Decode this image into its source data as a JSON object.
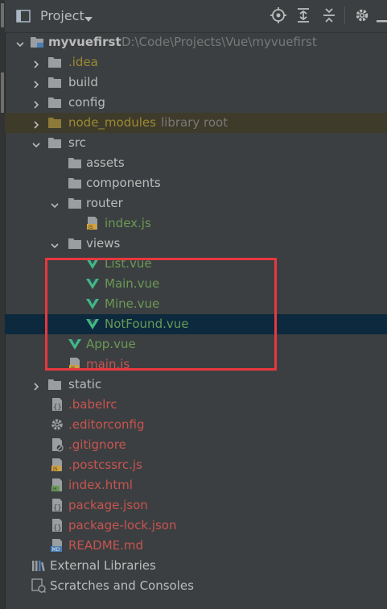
{
  "toolbar": {
    "title": "Project",
    "icons": [
      "project-view-icon",
      "dropdown-icon",
      "locate-icon",
      "expand-all-icon",
      "collapse-all-icon",
      "settings-icon",
      "hide-icon"
    ]
  },
  "colors": {
    "default_text": "#bbbbbb",
    "vue_file": "#6a9955",
    "js_file": "#c75450",
    "config_file": "#c75450",
    "excluded": "#9b8a32",
    "excluded_bg": "#3f3b2b",
    "selected_bg": "#0d293e",
    "highlight": "#e8383d",
    "folder": "#9a9ea1",
    "vue_green": "#41b883"
  },
  "tree": {
    "root": {
      "label": "myvuefirst",
      "path": "D:\\Code\\Projects\\Vue\\myvuefirst"
    },
    "items": [
      {
        "label": ".idea",
        "type": "folder",
        "state": "collapsed",
        "style": "vcs"
      },
      {
        "label": "build",
        "type": "folder",
        "state": "collapsed"
      },
      {
        "label": "config",
        "type": "folder",
        "state": "collapsed"
      },
      {
        "label": "node_modules",
        "extra": "library root",
        "type": "folder",
        "state": "collapsed",
        "style": "excluded"
      },
      {
        "label": "src",
        "type": "folder",
        "state": "expanded"
      },
      {
        "label": "assets",
        "type": "folder"
      },
      {
        "label": "components",
        "type": "folder"
      },
      {
        "label": "router",
        "type": "folder",
        "state": "expanded"
      },
      {
        "label": "index.js",
        "type": "js"
      },
      {
        "label": "views",
        "type": "folder",
        "state": "expanded"
      },
      {
        "label": "List.vue",
        "type": "vue"
      },
      {
        "label": "Main.vue",
        "type": "vue"
      },
      {
        "label": "Mine.vue",
        "type": "vue"
      },
      {
        "label": "NotFound.vue",
        "type": "vue",
        "selected": true
      },
      {
        "label": "App.vue",
        "type": "vue"
      },
      {
        "label": "main.js",
        "type": "js"
      },
      {
        "label": "static",
        "type": "folder",
        "state": "collapsed"
      },
      {
        "label": ".babelrc",
        "type": "config"
      },
      {
        "label": ".editorconfig",
        "type": "gear"
      },
      {
        "label": ".gitignore",
        "type": "ignore"
      },
      {
        "label": ".postcssrc.js",
        "type": "js"
      },
      {
        "label": "index.html",
        "type": "html"
      },
      {
        "label": "package.json",
        "type": "config"
      },
      {
        "label": "package-lock.json",
        "type": "config"
      },
      {
        "label": "README.md",
        "type": "md"
      }
    ],
    "external_libraries": "External Libraries",
    "scratches": "Scratches and Consoles"
  }
}
